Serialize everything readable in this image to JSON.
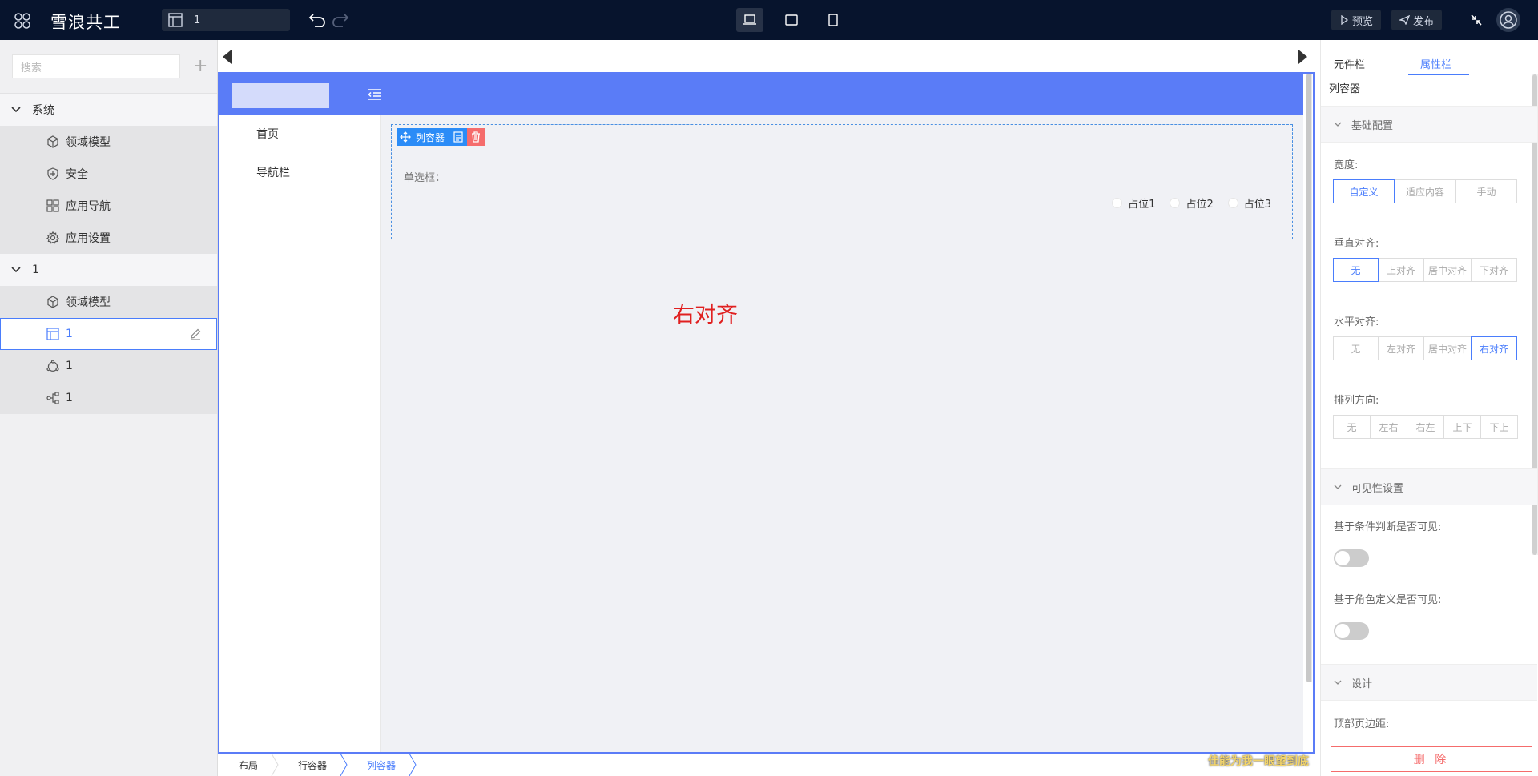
{
  "topbar": {
    "app_title": "雪浪共工",
    "page_select_value": "1",
    "preview_label": "预览",
    "publish_label": "发布"
  },
  "left_panel": {
    "search_placeholder": "搜索",
    "groups": [
      {
        "title": "系统",
        "items": [
          "领域模型",
          "安全",
          "应用导航",
          "应用设置"
        ]
      },
      {
        "title": "1",
        "items": [
          "领域模型",
          "1",
          "1",
          "1"
        ]
      }
    ]
  },
  "canvas": {
    "nav_items": [
      "首页",
      "导航栏"
    ],
    "container_tag": "列容器",
    "radio_label": "单选框：",
    "radio_options": [
      "占位1",
      "占位2",
      "占位3"
    ],
    "overlay_text": "右对齐"
  },
  "breadcrumbs": [
    "布局",
    "行容器",
    "列容器"
  ],
  "watermark": "佳能为我一眼望到底",
  "right_panel": {
    "tabs": [
      "元件栏",
      "属性栏"
    ],
    "active_tab": "属性栏",
    "component_name": "列容器",
    "sections": {
      "basic": "基础配置",
      "visibility": "可见性设置",
      "design": "设计"
    },
    "width": {
      "label": "宽度:",
      "options": [
        "自定义",
        "适应内容",
        "手动"
      ],
      "selected": "自定义"
    },
    "vertical_align": {
      "label": "垂直对齐:",
      "options": [
        "无",
        "上对齐",
        "居中对齐",
        "下对齐"
      ],
      "selected": "无"
    },
    "horizontal_align": {
      "label": "水平对齐:",
      "options": [
        "无",
        "左对齐",
        "居中对齐",
        "右对齐"
      ],
      "selected": "右对齐"
    },
    "direction": {
      "label": "排列方向:",
      "options": [
        "无",
        "左右",
        "右左",
        "上下",
        "下上"
      ]
    },
    "visible_by_condition": {
      "label": "基于条件判断是否可见:",
      "value": false
    },
    "visible_by_role": {
      "label": "基于角色定义是否可见:",
      "value": false
    },
    "top_margin_label": "顶部页边距:",
    "delete_label": "删 除"
  },
  "colors": {
    "topbar_bg": "#07142d",
    "accent": "#4a7dfc",
    "app_header": "#5a7cf7",
    "danger": "#f56c6c",
    "overlay_text": "#e02020"
  }
}
